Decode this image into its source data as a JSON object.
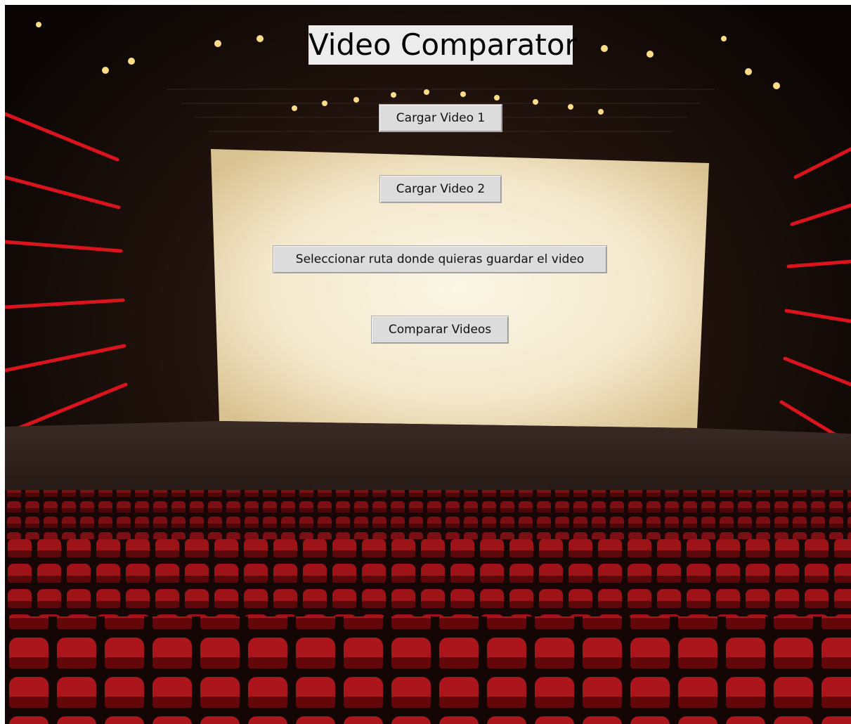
{
  "app": {
    "title": "Video Comparator"
  },
  "buttons": {
    "load_video_1": "Cargar Video 1",
    "load_video_2": "Cargar Video 2",
    "select_save_path": "Seleccionar ruta donde quieras guardar el video",
    "compare_videos": "Comparar Videos"
  },
  "background": {
    "image": "cinema-auditorium-background",
    "accent_color": "#c0141c",
    "screen_color": "#f4e8cc"
  }
}
